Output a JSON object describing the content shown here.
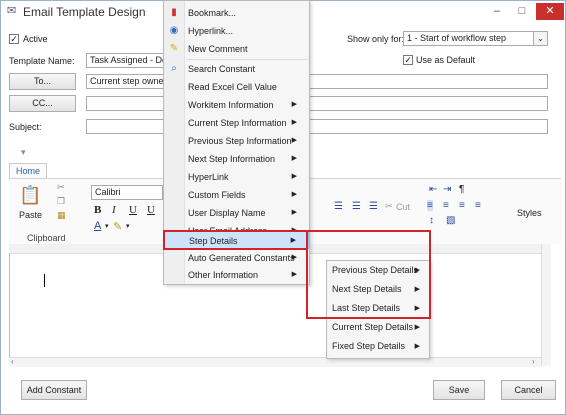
{
  "window": {
    "title": "Email Template Design",
    "minimize": "–",
    "maximize": "□",
    "close": "✕"
  },
  "form": {
    "active_label": "Active",
    "active_checked": true,
    "template_name_label": "Template Name:",
    "template_name_value": "Task Assigned - Defa",
    "show_only_for_label": "Show only for:",
    "show_only_for_value": "1 - Start of workflow step",
    "use_as_default_label": "Use as Default",
    "use_as_default_checked": true,
    "to_button": "To...",
    "to_value": "Current step owner(s",
    "cc_button": "CC...",
    "cc_value": "",
    "subject_label": "Subject:",
    "subject_value": ""
  },
  "ribbon": {
    "tab_home": "Home",
    "paste_label": "Paste",
    "clipboard_label": "Clipboard",
    "font_name": "Calibri",
    "bold": "B",
    "italic": "I",
    "underline": "U",
    "cut_label": "Cut",
    "styles_label": "Styles"
  },
  "context_menu": {
    "items": [
      {
        "label": "Bookmark...",
        "icon": "bookmark-icon",
        "arrow": false
      },
      {
        "label": "Hyperlink...",
        "icon": "globe-icon",
        "arrow": false
      },
      {
        "label": "New Comment",
        "icon": "comment-icon",
        "arrow": false
      },
      {
        "label": "Search Constant",
        "icon": "search-icon",
        "arrow": false
      },
      {
        "label": "Read Excel Cell Value",
        "icon": "",
        "arrow": false
      },
      {
        "label": "Workitem Information",
        "icon": "",
        "arrow": true
      },
      {
        "label": "Current Step Information",
        "icon": "",
        "arrow": true
      },
      {
        "label": "Previous Step Information",
        "icon": "",
        "arrow": true
      },
      {
        "label": "Next Step Information",
        "icon": "",
        "arrow": true
      },
      {
        "label": "HyperLink",
        "icon": "",
        "arrow": true
      },
      {
        "label": "Custom Fields",
        "icon": "",
        "arrow": true
      },
      {
        "label": "User Display Name",
        "icon": "",
        "arrow": true
      },
      {
        "label": "User Email Address",
        "icon": "",
        "arrow": true
      },
      {
        "label": "Step Details",
        "icon": "",
        "arrow": true,
        "highlighted": true
      },
      {
        "label": "Auto Generated Constants",
        "icon": "",
        "arrow": true
      },
      {
        "label": "Other Information",
        "icon": "",
        "arrow": true
      }
    ],
    "arrow_glyph": "▶"
  },
  "submenu": {
    "items": [
      {
        "label": "Previous Step Details"
      },
      {
        "label": "Next Step Details"
      },
      {
        "label": "Last Step Details"
      },
      {
        "label": "Current Step Details"
      },
      {
        "label": "Fixed Step Details"
      }
    ],
    "arrow_glyph": "▶"
  },
  "footer": {
    "add_constant": "Add Constant",
    "save": "Save",
    "cancel": "Cancel"
  },
  "colors": {
    "highlight": "#cde3fa",
    "red_outline": "#d2232a",
    "close_button": "#c9302c"
  }
}
